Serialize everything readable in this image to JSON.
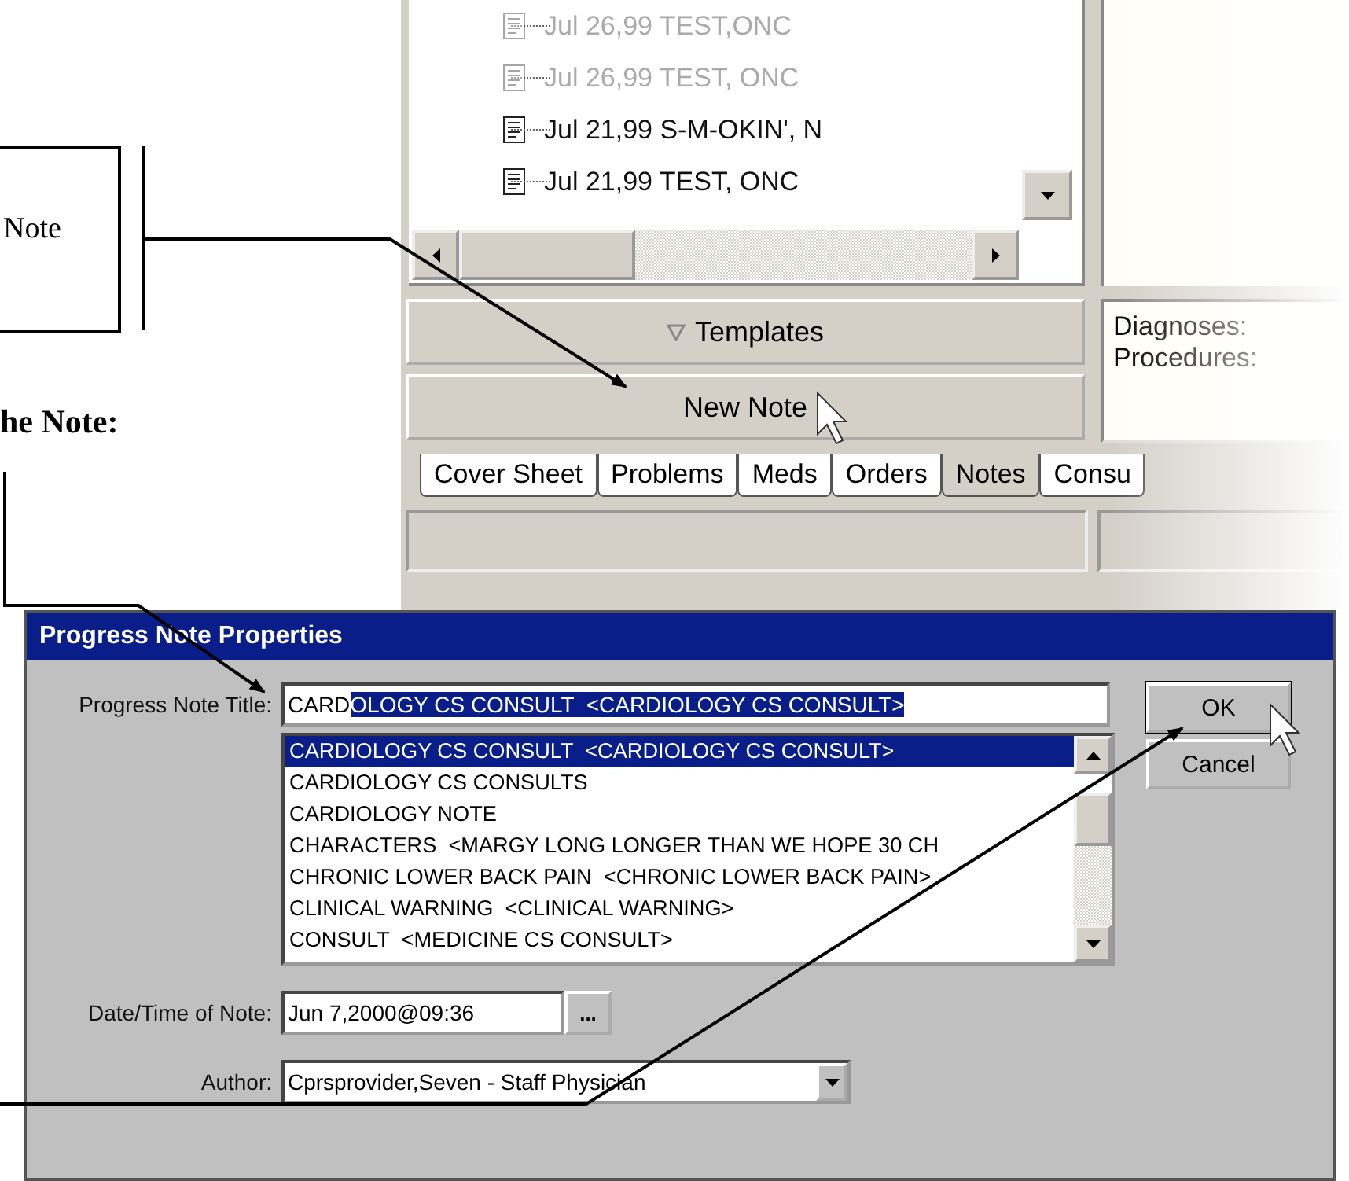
{
  "callout": {
    "text": "Note"
  },
  "heading": "he Note:",
  "notes_window": {
    "notes": [
      {
        "date": "Jul 26,99",
        "title": "TEST,ONC"
      },
      {
        "date": "Jul 26,99",
        "title": "TEST, ONC"
      },
      {
        "date": "Jul 21,99",
        "title": "S-M-OKIN', N"
      },
      {
        "date": "Jul 21,99",
        "title": "TEST, ONC"
      }
    ],
    "buttons": [
      {
        "label": "Templates",
        "kind": "dropdown"
      },
      {
        "label": "New Note",
        "kind": "plain"
      }
    ],
    "info_panel": [
      "Diagnoses:",
      "Procedures:"
    ],
    "tabs": [
      {
        "label": "Cover Sheet",
        "selected": false
      },
      {
        "label": "Problems",
        "selected": false
      },
      {
        "label": "Meds",
        "selected": false
      },
      {
        "label": "Orders",
        "selected": false
      },
      {
        "label": "Notes",
        "selected": true
      },
      {
        "label": "Consu",
        "selected": false
      }
    ]
  },
  "dialog": {
    "title": "Progress Note Properties",
    "title_field": {
      "label": "Progress Note Title:",
      "typed": "CARD",
      "completion": "OLOGY CS CONSULT  <CARDIOLOGY CS CONSULT>"
    },
    "title_list": [
      {
        "text": "CARDIOLOGY CS CONSULT  <CARDIOLOGY CS CONSULT>",
        "selected": true
      },
      {
        "text": "CARDIOLOGY CS CONSULTS",
        "selected": false
      },
      {
        "text": "CARDIOLOGY NOTE",
        "selected": false
      },
      {
        "text": "CHARACTERS  <MARGY LONG LONGER THAN WE HOPE 30 CH",
        "selected": false
      },
      {
        "text": "CHRONIC LOWER BACK PAIN  <CHRONIC LOWER BACK PAIN>",
        "selected": false
      },
      {
        "text": "CLINICAL WARNING  <CLINICAL WARNING>",
        "selected": false
      },
      {
        "text": "CONSULT  <MEDICINE CS CONSULT>",
        "selected": false
      }
    ],
    "date_field": {
      "label": "Date/Time of Note:",
      "value": "Jun 7,2000@09:36",
      "button": "..."
    },
    "author_field": {
      "label": "Author:",
      "value": "Cprsprovider,Seven - Staff Physician"
    },
    "buttons": [
      "OK",
      "Cancel"
    ]
  }
}
